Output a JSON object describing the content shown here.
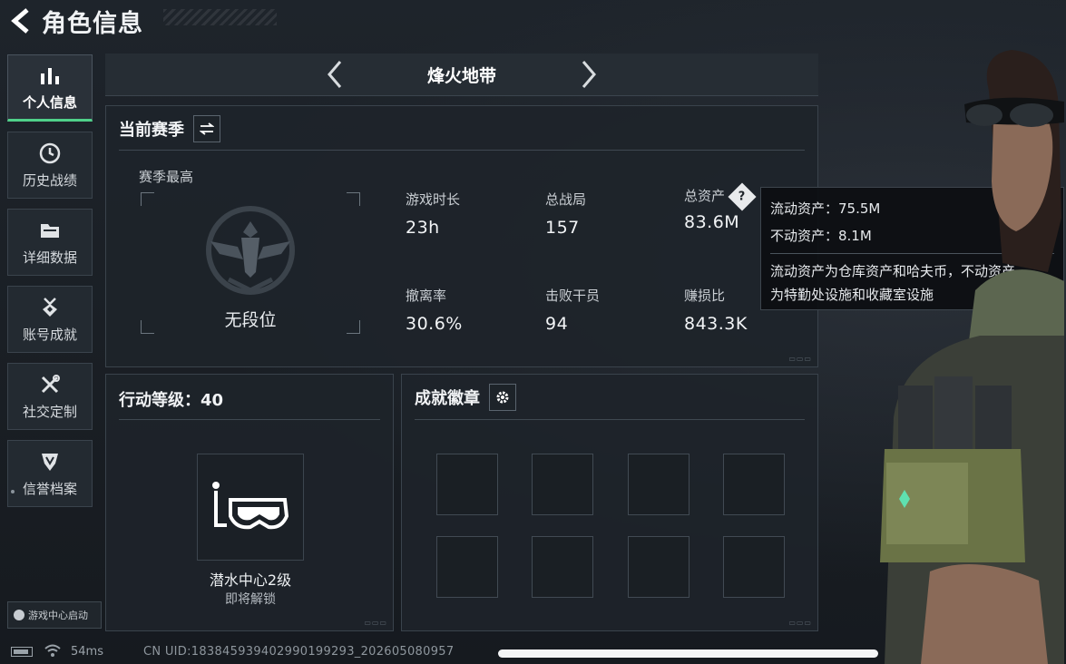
{
  "header": {
    "title": "角色信息"
  },
  "sidebar": {
    "items": [
      {
        "label": "个人信息",
        "icon": "bar-chart-icon",
        "active": true
      },
      {
        "label": "历史战绩",
        "icon": "history-clock-icon",
        "active": false
      },
      {
        "label": "详细数据",
        "icon": "folder-icon",
        "active": false
      },
      {
        "label": "账号成就",
        "icon": "medal-icon",
        "active": false
      },
      {
        "label": "社交定制",
        "icon": "tools-icon",
        "active": false
      },
      {
        "label": "信誉档案",
        "icon": "shield-icon",
        "active": false
      }
    ],
    "game_center": "游戏中心启动"
  },
  "mode": {
    "title": "烽火地带"
  },
  "season": {
    "title": "当前赛季",
    "rank_label": "赛季最高",
    "rank_name": "无段位",
    "stats": [
      {
        "key": "游戏时长",
        "value": "23h"
      },
      {
        "key": "总战局",
        "value": "157"
      },
      {
        "key": "总资产",
        "value": "83.6M"
      },
      {
        "key": "撤离率",
        "value": "30.6%"
      },
      {
        "key": "击败干员",
        "value": "94"
      },
      {
        "key": "赚损比",
        "value": "843.3K"
      }
    ]
  },
  "tooltip": {
    "liquid": "流动资产：75.5M",
    "fixed": "不动资产：8.1M",
    "desc_line1": "流动资产为仓库资产和哈夫币，不动资产",
    "desc_line2": "为特勤处设施和收藏室设施"
  },
  "level": {
    "title": "行动等级：40",
    "facility_name": "潜水中心2级",
    "facility_status": "即将解锁"
  },
  "badges": {
    "title": "成就徽章",
    "slot_count": 8
  },
  "status": {
    "ping": "54ms",
    "uid": "CN UID:1838459394029901992​93_202605080957"
  },
  "colors": {
    "accent": "#4fd08a",
    "background": "#1a1f25",
    "panel": "#1e242a"
  }
}
